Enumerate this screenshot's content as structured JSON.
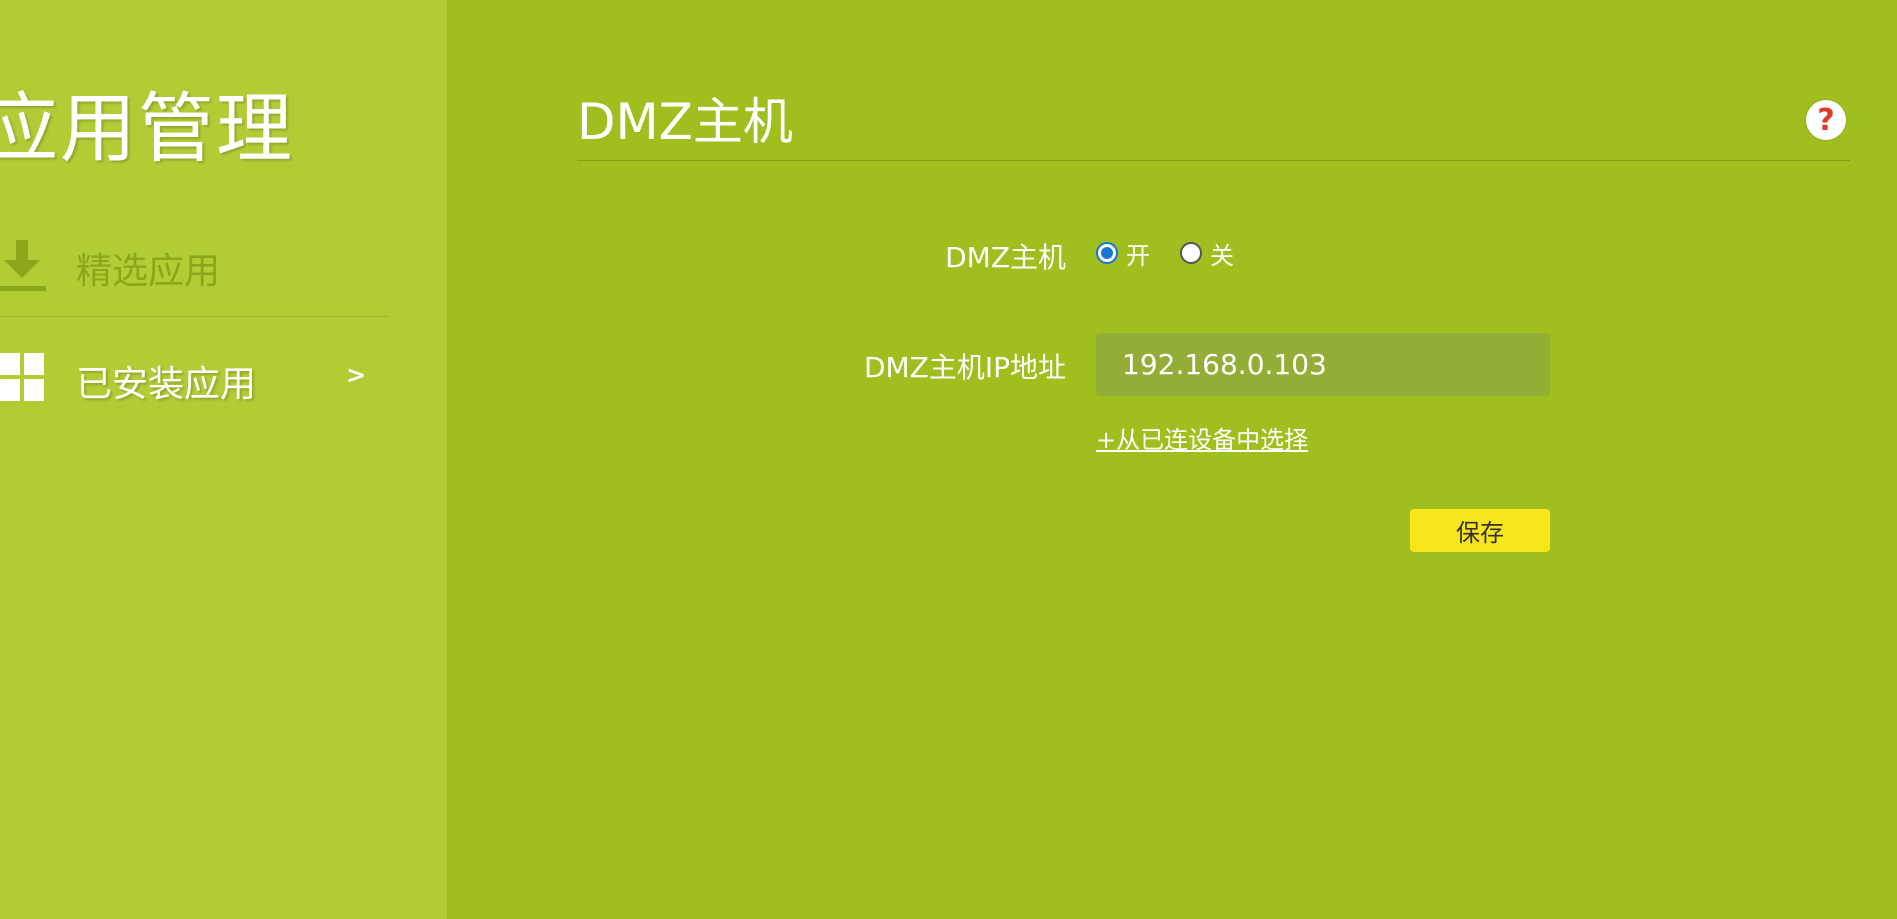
{
  "sidebar": {
    "title": "应用管理",
    "items": [
      {
        "label": "精选应用",
        "icon": "download-icon"
      },
      {
        "label": "已安装应用",
        "icon": "apps-grid-icon",
        "chevron": ">"
      }
    ]
  },
  "main": {
    "title": "DMZ主机",
    "help_icon": "?",
    "form": {
      "dmz_label": "DMZ主机",
      "radio_on": "开",
      "radio_off": "关",
      "selected": "on",
      "ip_label": "DMZ主机IP地址",
      "ip_value": "192.168.0.103",
      "select_link": "+从已连设备中选择",
      "save_label": "保存"
    }
  },
  "colors": {
    "main_bg": "#9fbf1e",
    "sidebar_bg": "#b1cc35",
    "save_button": "#f7e61c",
    "help_icon": "#e03a2a"
  }
}
